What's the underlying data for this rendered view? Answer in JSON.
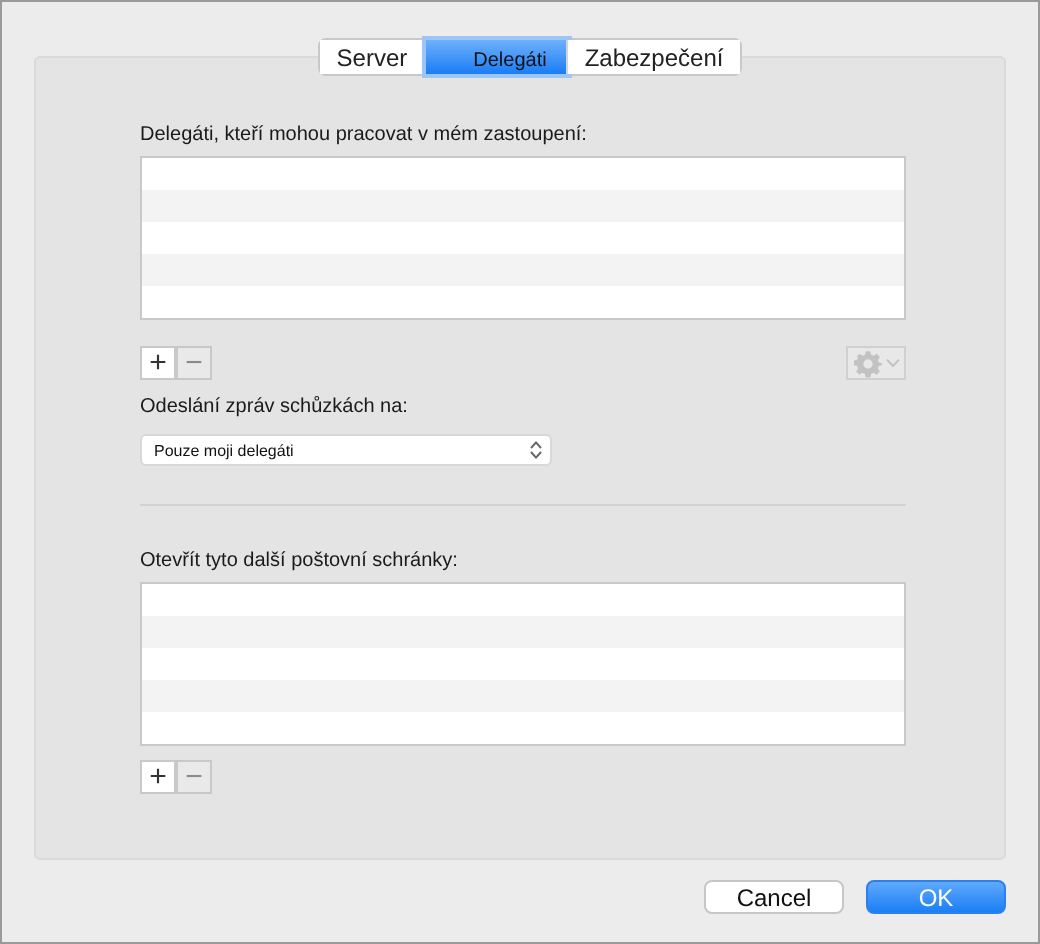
{
  "tabs": [
    {
      "label": "Server",
      "selected": false
    },
    {
      "label": "Delegáti",
      "selected": true
    },
    {
      "label": "Zabezpečení",
      "selected": false
    }
  ],
  "delegates": {
    "label": "Delegáti, kteří mohou pracovat v mém zastoupení:",
    "add": {
      "label": "+",
      "disabled": false
    },
    "remove": {
      "label": "−",
      "disabled": true
    },
    "action_menu": {
      "disabled": true
    }
  },
  "meeting_messages": {
    "label": "Odeslání zpráv schůzkách na:",
    "value": "Pouze moji delegáti"
  },
  "mailboxes": {
    "label": "Otevřít tyto další poštovní schránky:",
    "add": {
      "label": "+",
      "disabled": false
    },
    "remove": {
      "label": "−",
      "disabled": true
    }
  },
  "buttons": [
    {
      "label": "Cancel",
      "kind": "secondary"
    },
    {
      "label": "OK",
      "kind": "primary"
    }
  ]
}
